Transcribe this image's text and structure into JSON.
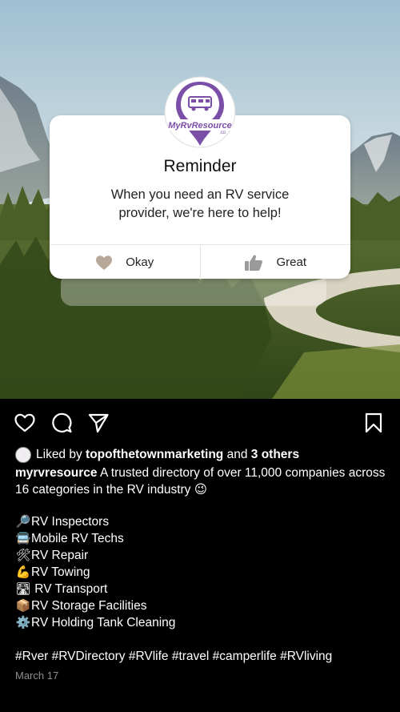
{
  "reminder": {
    "logo_text": "MyRvResource",
    "logo_sub": ".co",
    "title": "Reminder",
    "message_line1": "When you need an RV service",
    "message_line2": "provider, we're here to help!",
    "okay_label": "Okay",
    "great_label": "Great"
  },
  "post": {
    "liked_prefix": "Liked by",
    "liked_user": "topofthetownmarketing",
    "liked_and": "and",
    "liked_others": "3 others",
    "username": "myrvresource",
    "caption_text": "A trusted directory of over 11,000 companies across 16 categories in the RV industry",
    "caption_emoji": "😉",
    "list": [
      {
        "emoji": "🔎",
        "text": "RV Inspectors"
      },
      {
        "emoji": "🚍",
        "text": "Mobile RV Techs"
      },
      {
        "emoji": "🛠",
        "text": "RV Repair"
      },
      {
        "emoji": "💪",
        "text": "RV Towing"
      },
      {
        "emoji": "🛣",
        "text": " RV Transport"
      },
      {
        "emoji": "📦",
        "text": "RV Storage Facilities"
      },
      {
        "emoji": "⚙️",
        "text": "RV Holding Tank Cleaning"
      }
    ],
    "hashtags": "#Rver #RVDirectory #RVlife #travel #camperlife #RVliving",
    "date": "March 17"
  },
  "icons": {
    "like": "heart-icon",
    "comment": "comment-icon",
    "share": "send-icon",
    "save": "bookmark-icon"
  },
  "colors": {
    "brand_purple": "#7b4fa8",
    "background": "#000000",
    "secondary_text": "#8e8e8e"
  }
}
